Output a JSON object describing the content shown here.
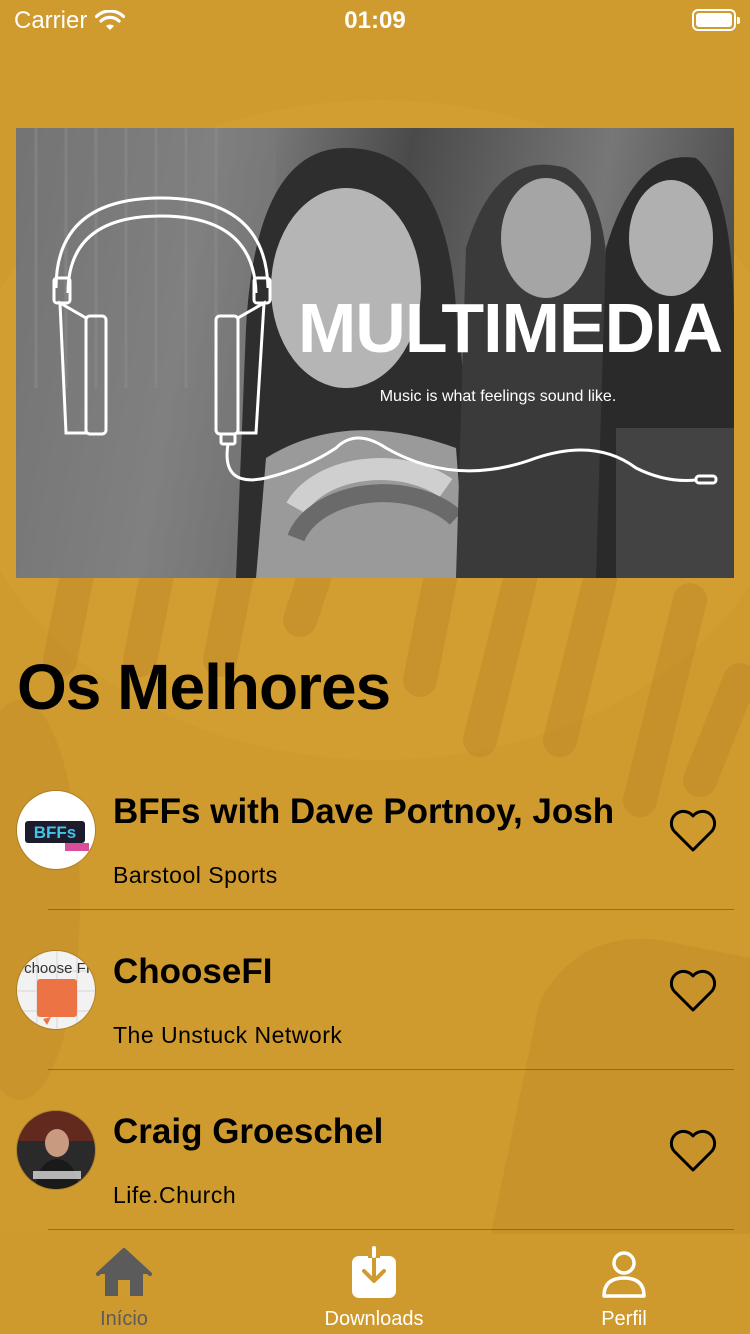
{
  "status_bar": {
    "carrier": "Carrier",
    "time": "01:09",
    "icons": [
      "wifi-icon",
      "battery-icon"
    ]
  },
  "banner": {
    "title": "MULTIMEDIA",
    "tagline": "Music is what feelings sound like.",
    "icon": "headphones-icon"
  },
  "section": {
    "title": "Os Melhores"
  },
  "podcasts": [
    {
      "title": "BFFs with Dave Portnoy, Josh",
      "subtitle": "Barstool Sports",
      "art_text": "BFFs",
      "icon": "heart-icon"
    },
    {
      "title": "ChooseFI",
      "subtitle": "The Unstuck Network",
      "art_text": "choose FI",
      "icon": "heart-icon"
    },
    {
      "title": "Craig Groeschel",
      "subtitle": "Life.Church",
      "art_text": "",
      "icon": "heart-icon"
    }
  ],
  "tab_bar": {
    "items": [
      {
        "label": "Início",
        "icon": "home-icon",
        "color": "#5b5b5b"
      },
      {
        "label": "Downloads",
        "icon": "download-icon",
        "color": "#ffffff"
      },
      {
        "label": "Perfil",
        "icon": "person-icon",
        "color": "#ffffff"
      }
    ]
  },
  "colors": {
    "background": "#cf9a2e",
    "text": "#000000",
    "tab_inactive": "#5b5b5b",
    "tab_active": "#ffffff"
  }
}
